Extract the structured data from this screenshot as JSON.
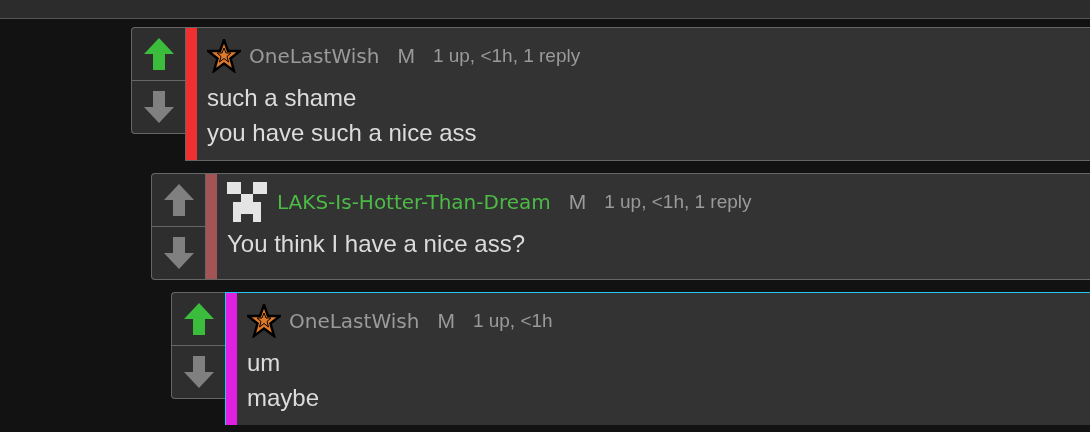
{
  "comments": [
    {
      "avatar": {
        "kind": "star"
      },
      "username": "OneLastWish",
      "name_highlight": false,
      "badge": "M",
      "meta": "1 up, <1h, 1 reply",
      "upvoted": true,
      "downvoted": false,
      "color": "#f03030",
      "focused": false,
      "lines": [
        "such a shame",
        "you have such a nice ass"
      ]
    },
    {
      "avatar": {
        "kind": "blocky"
      },
      "username": "LAKS-Is-Hotter-Than-Dream",
      "name_highlight": true,
      "badge": "M",
      "meta": "1 up, <1h, 1 reply",
      "upvoted": false,
      "downvoted": false,
      "color": "#a35555",
      "focused": false,
      "lines": [
        "You think I have a nice ass?"
      ]
    },
    {
      "avatar": {
        "kind": "star"
      },
      "username": "OneLastWish",
      "name_highlight": false,
      "badge": "M",
      "meta": "1 up, <1h",
      "upvoted": true,
      "downvoted": false,
      "color": "#e020e0",
      "focused": true,
      "lines": [
        "um",
        "maybe"
      ]
    }
  ]
}
